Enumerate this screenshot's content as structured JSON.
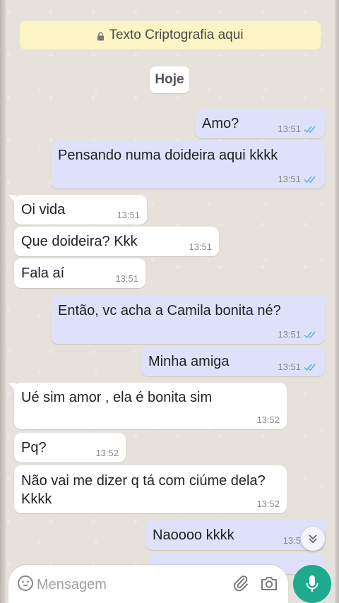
{
  "banner": {
    "text": "Texto Criptografia aqui"
  },
  "date_chip": "Hoje",
  "messages": [
    {
      "dir": "out",
      "text": "Amo?",
      "time": "13:51",
      "read": true
    },
    {
      "dir": "out",
      "text": "Pensando numa doideira aqui kkkk",
      "time": "13:51",
      "read": true
    },
    {
      "dir": "in",
      "text": "Oi vida",
      "time": "13:51"
    },
    {
      "dir": "in",
      "text": "Que doideira? Kkk",
      "time": "13:51"
    },
    {
      "dir": "in",
      "text": "Fala aí",
      "time": "13:51"
    },
    {
      "dir": "out",
      "text": "Então, vc acha a Camila bonita né?",
      "time": "13:51",
      "read": true
    },
    {
      "dir": "out",
      "text": "Minha amiga",
      "time": "13:51",
      "read": true
    },
    {
      "dir": "in",
      "text": "Ué sim amor , ela é bonita sim",
      "time": "13:52"
    },
    {
      "dir": "in",
      "text": "Pq?",
      "time": "13:52"
    },
    {
      "dir": "in",
      "text": "Não vai me dizer q tá com ciúme dela?",
      "text2": "Kkkk",
      "time": "13:52"
    },
    {
      "dir": "out",
      "text": "Naoooo kkkk",
      "time": "13:5"
    }
  ],
  "composer": {
    "placeholder": "Mensagem"
  },
  "colors": {
    "outgoing": "#dfe1fb",
    "incoming": "#ffffff",
    "read_ticks": "#4fb6ec",
    "mic": "#1eaa8e"
  },
  "icons": [
    "lock-icon",
    "double-check-icon",
    "chevron-double-down-icon",
    "emoji-icon",
    "paperclip-icon",
    "camera-icon",
    "microphone-icon"
  ]
}
